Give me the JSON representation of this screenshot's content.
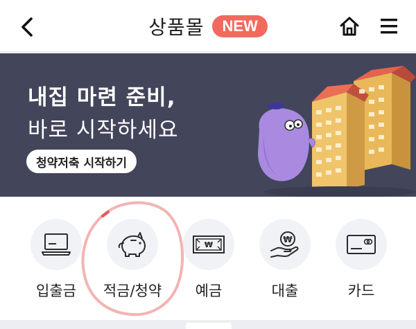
{
  "header": {
    "title": "상품몰",
    "badge": "NEW",
    "icons": {
      "back": "chevron-left-icon",
      "home": "home-icon",
      "menu": "hamburger-menu-icon"
    }
  },
  "banner": {
    "headline": "내집 마련 준비,",
    "subline": "바로 시작하세요",
    "button_label": "청약저축 시작하기",
    "background_color": "#43455b"
  },
  "products": [
    {
      "label": "입출금",
      "icon": "laptop-icon"
    },
    {
      "label": "적금/청약",
      "icon": "piggy-bank-icon"
    },
    {
      "label": "예금",
      "icon": "won-banknote-icon"
    },
    {
      "label": "대출",
      "icon": "hand-won-coin-icon"
    },
    {
      "label": "카드",
      "icon": "credit-card-icon"
    }
  ],
  "colors": {
    "accent": "#f26a5e",
    "highlight_circle": "#f2a6a6"
  }
}
